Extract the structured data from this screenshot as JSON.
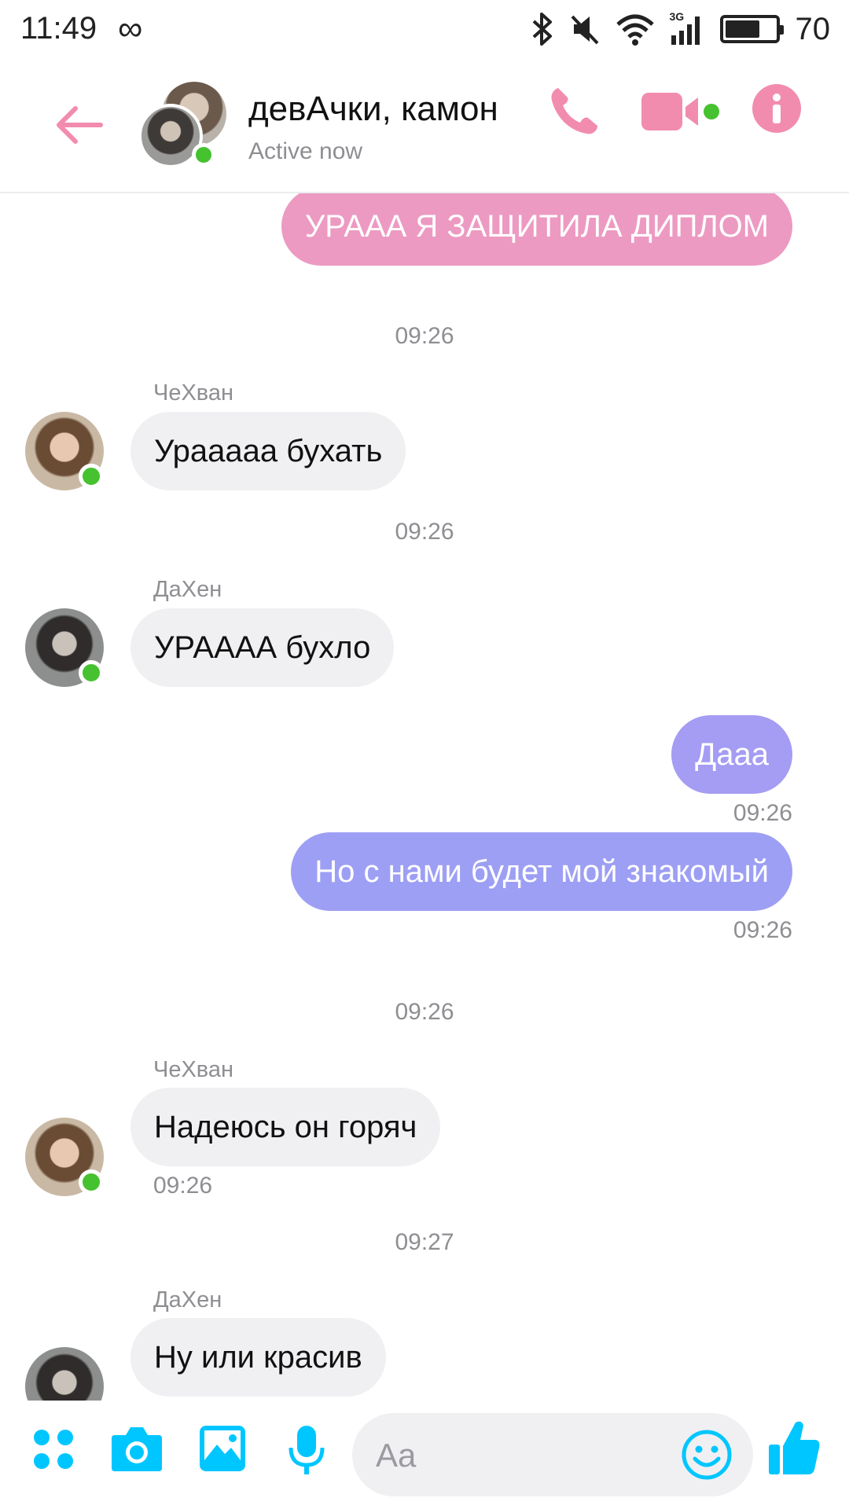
{
  "status_bar": {
    "time": "11:49",
    "infinity_icon": "∞",
    "icons": [
      "bluetooth-icon",
      "mute-icon",
      "wifi-icon",
      "3g-signal-icon",
      "battery-icon"
    ],
    "network_label": "3G",
    "battery_percent": "70",
    "battery_level": 0.7
  },
  "header": {
    "title": "девАчки, камон",
    "subtitle": "Active now",
    "accent_color": "#f28cae",
    "online_color": "#46c12f",
    "icons": [
      "back-arrow-icon",
      "phone-icon",
      "video-icon",
      "info-icon"
    ]
  },
  "messages": [
    {
      "text": "УРААА Я ЗАЩИТИЛА ДИПЛОМ",
      "direction": "out",
      "color": "#ec9ac2"
    },
    {
      "timestamp": "09:26"
    },
    {
      "sender": "ЧеХван",
      "text": "Урааааа бухать",
      "direction": "in"
    },
    {
      "timestamp": "09:26"
    },
    {
      "sender": "ДаХен",
      "text": "УРАААА бухло",
      "direction": "in"
    },
    {
      "text": "Дааа",
      "direction": "out",
      "time": "09:26",
      "color": "#a59cf3"
    },
    {
      "text": "Но с нами будет мой знакомый",
      "direction": "out",
      "time": "09:26",
      "color": "#9d9ff4"
    },
    {
      "timestamp": "09:26"
    },
    {
      "sender": "ЧеХван",
      "text": "Надеюсь он горяч",
      "direction": "in",
      "time": "09:26"
    },
    {
      "timestamp": "09:27"
    },
    {
      "sender": "ДаХен",
      "text": "Ну или красив",
      "direction": "in"
    }
  ],
  "composer": {
    "placeholder": "Aa",
    "accent_color": "#00c6ff",
    "icons": [
      "apps-grid-icon",
      "camera-icon",
      "gallery-icon",
      "microphone-icon",
      "emoji-icon",
      "thumbs-up-icon"
    ]
  }
}
